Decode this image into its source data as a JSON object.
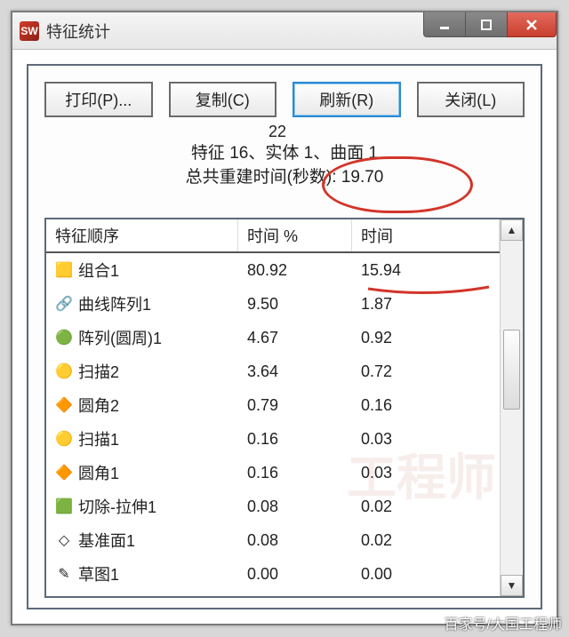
{
  "window": {
    "title": "特征统计"
  },
  "buttons": {
    "print": "打印(P)...",
    "copy": "复制(C)",
    "refresh": "刷新(R)",
    "close": "关闭(L)"
  },
  "summary": {
    "topnum": "22",
    "line1_a": "特征 16、",
    "line1_b": "实体 1、",
    "line1_c": "曲面 1",
    "line2_a": "总共重建时间(秒数): ",
    "line2_b": "19.70"
  },
  "table": {
    "headers": {
      "order": "特征顺序",
      "pct": "时间 %",
      "time": "时间"
    },
    "rows": [
      {
        "icon": "🟨",
        "iconName": "combine-icon",
        "name": "组合1",
        "pct": "80.92",
        "time": "15.94"
      },
      {
        "icon": "🔗",
        "iconName": "curve-pattern-icon",
        "name": "曲线阵列1",
        "pct": "9.50",
        "time": "1.87"
      },
      {
        "icon": "🟢",
        "iconName": "circular-pattern-icon",
        "name": "阵列(圆周)1",
        "pct": "4.67",
        "time": "0.92"
      },
      {
        "icon": "🟡",
        "iconName": "sweep-icon",
        "name": "扫描2",
        "pct": "3.64",
        "time": "0.72"
      },
      {
        "icon": "🔶",
        "iconName": "fillet-icon",
        "name": "圆角2",
        "pct": "0.79",
        "time": "0.16"
      },
      {
        "icon": "🟡",
        "iconName": "sweep-icon",
        "name": "扫描1",
        "pct": "0.16",
        "time": "0.03"
      },
      {
        "icon": "🔶",
        "iconName": "fillet-icon",
        "name": "圆角1",
        "pct": "0.16",
        "time": "0.03"
      },
      {
        "icon": "🟩",
        "iconName": "cut-extrude-icon",
        "name": "切除-拉伸1",
        "pct": "0.08",
        "time": "0.02"
      },
      {
        "icon": "◇",
        "iconName": "plane-icon",
        "name": "基准面1",
        "pct": "0.08",
        "time": "0.02"
      },
      {
        "icon": "✎",
        "iconName": "sketch-icon",
        "name": "草图1",
        "pct": "0.00",
        "time": "0.00"
      }
    ]
  },
  "watermark": "百家号/大国工程师"
}
